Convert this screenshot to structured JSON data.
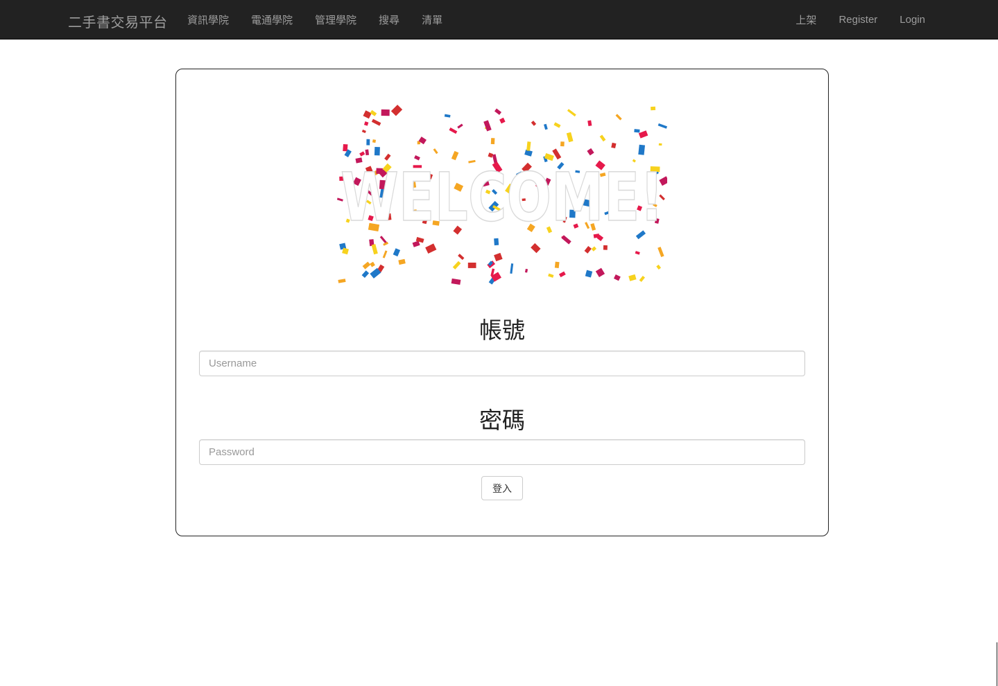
{
  "navbar": {
    "brand": "二手書交易平台",
    "left_items": [
      {
        "label": "資訊學院"
      },
      {
        "label": "電通學院"
      },
      {
        "label": "管理學院"
      },
      {
        "label": "搜尋"
      },
      {
        "label": "清單"
      }
    ],
    "right_items": [
      {
        "label": "上架"
      },
      {
        "label": "Register"
      },
      {
        "label": "Login"
      }
    ]
  },
  "login": {
    "banner_text": "WELCOME!",
    "username_title": "帳號",
    "username_placeholder": "Username",
    "password_title": "密碼",
    "password_placeholder": "Password",
    "submit_label": "登入"
  },
  "colors": {
    "navbar_bg": "#222222",
    "navbar_text": "#9d9d9d",
    "confetti": [
      "#e6194b",
      "#f5a623",
      "#1f78c8",
      "#c2185b",
      "#f7d21e",
      "#d32f2f"
    ]
  }
}
